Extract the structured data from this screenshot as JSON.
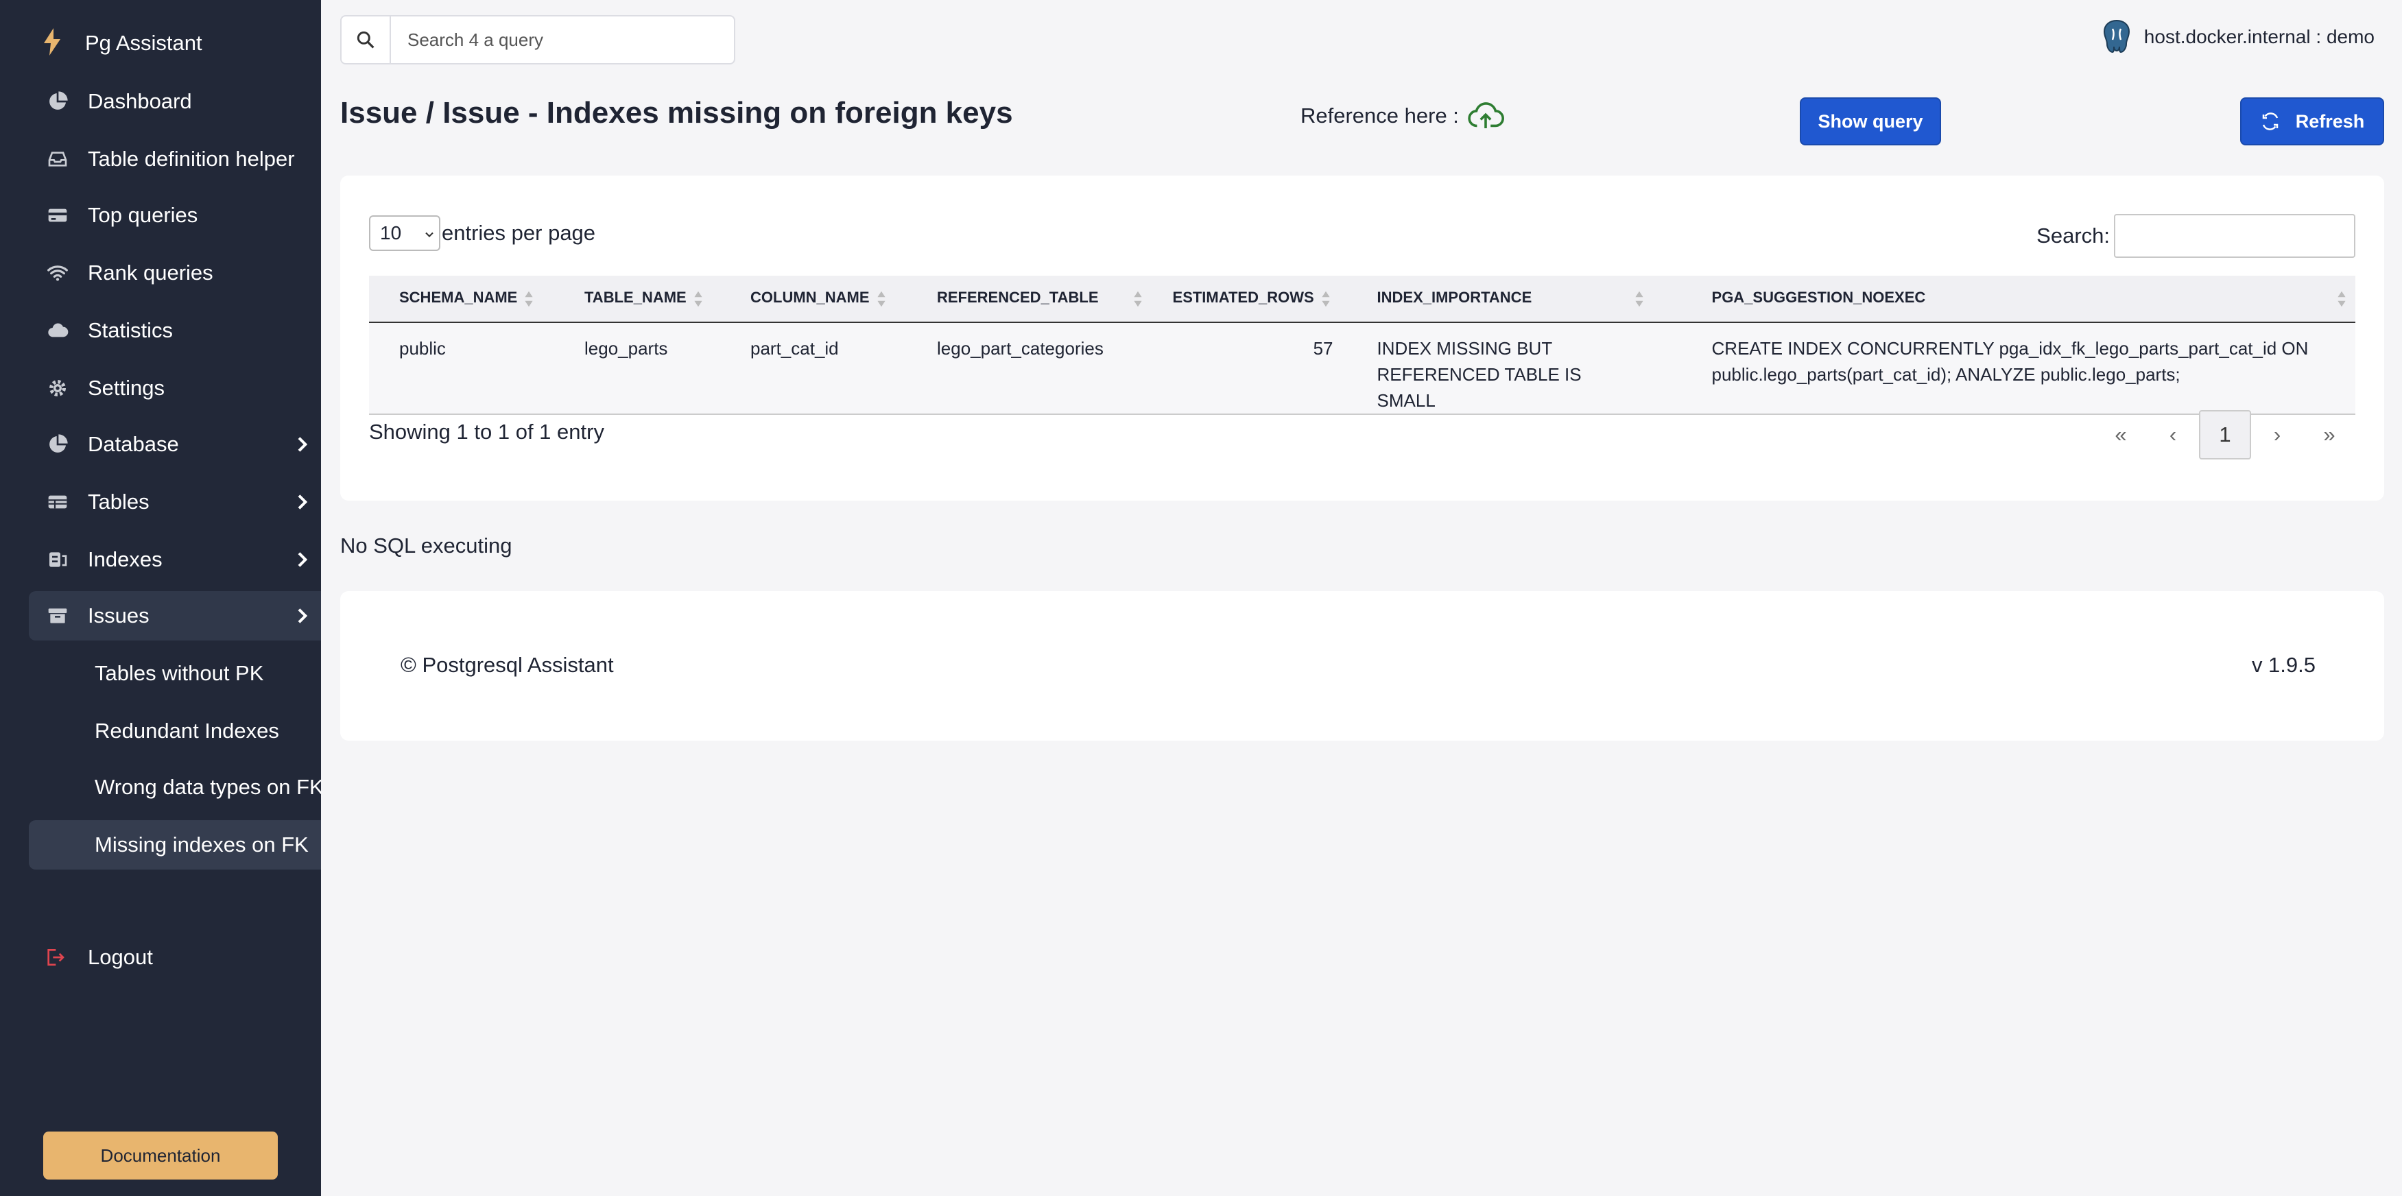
{
  "sidebar": {
    "brand": "Pg Assistant",
    "items": [
      {
        "label": "Dashboard",
        "icon": "pie-chart-icon"
      },
      {
        "label": "Table definition helper",
        "icon": "inbox-icon"
      },
      {
        "label": "Top queries",
        "icon": "credit-card-icon"
      },
      {
        "label": "Rank queries",
        "icon": "wifi-icon"
      },
      {
        "label": "Statistics",
        "icon": "cloud-icon"
      },
      {
        "label": "Settings",
        "icon": "gear-icon"
      },
      {
        "label": "Database",
        "icon": "pie-chart-icon"
      },
      {
        "label": "Tables",
        "icon": "table-icon"
      },
      {
        "label": "Indexes",
        "icon": "index-icon"
      },
      {
        "label": "Issues",
        "icon": "archive-icon"
      }
    ],
    "sub_items": [
      {
        "label": "Tables without PK"
      },
      {
        "label": "Redundant Indexes"
      },
      {
        "label": "Wrong data types on FK"
      },
      {
        "label": "Missing indexes on FK"
      }
    ],
    "logout": "Logout",
    "documentation": "Documentation"
  },
  "topbar": {
    "search_placeholder": "Search 4 a query",
    "host": "host.docker.internal : demo"
  },
  "page": {
    "title": "Issue / Issue - Indexes missing on foreign keys",
    "reference_label": "Reference here :",
    "show_query": "Show query",
    "refresh": "Refresh"
  },
  "table": {
    "entries_value": "10",
    "entries_label": "entries per page",
    "search_label": "Search:",
    "columns": [
      "SCHEMA_NAME",
      "TABLE_NAME",
      "COLUMN_NAME",
      "REFERENCED_TABLE",
      "ESTIMATED_ROWS",
      "INDEX_IMPORTANCE",
      "PGA_SUGGESTION_NOEXEC"
    ],
    "rows": [
      [
        "public",
        "lego_parts",
        "part_cat_id",
        "lego_part_categories",
        "57",
        "INDEX MISSING BUT REFERENCED TABLE IS SMALL",
        "CREATE INDEX CONCURRENTLY pga_idx_fk_lego_parts_part_cat_id ON public.lego_parts(part_cat_id); ANALYZE public.lego_parts;"
      ]
    ],
    "showing": "Showing 1 to 1 of 1 entry",
    "pager": {
      "first": "«",
      "prev": "‹",
      "current": "1",
      "next": "›",
      "last": "»"
    }
  },
  "status": "No SQL executing",
  "footer": {
    "copyright": "© Postgresql Assistant",
    "version": "v 1.9.5"
  },
  "colors": {
    "sidebar_bg": "#222838",
    "primary": "#2058d0",
    "doc_button": "#e8b56e",
    "brand_bolt": "#e8b56e",
    "logout_icon": "#e0454f",
    "cloud_icon": "#2e7d32"
  }
}
